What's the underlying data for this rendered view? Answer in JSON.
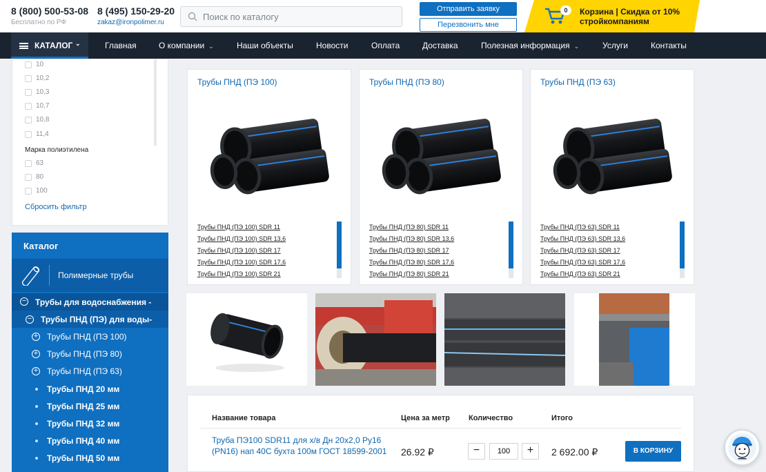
{
  "header": {
    "phone1": "8 (800) 500-53-08",
    "phone1_note": "Бесплатно по РФ",
    "phone2": "8 (495) 150-29-20",
    "email": "zakaz@ironpolimer.ru",
    "search_placeholder": "Поиск по каталогу",
    "request_button": "Отправить заявку",
    "callback_button": "Перезвонить мне",
    "cart_count": "0",
    "cart_text": "Корзина | Скидка от 10% стройкомпаниям"
  },
  "nav": {
    "catalog_label": "КАТАЛОГ",
    "items": [
      "Главная",
      "О компании",
      "Наши объекты",
      "Новости",
      "Оплата",
      "Доставка",
      "Полезная информация",
      "Услуги",
      "Контакты"
    ]
  },
  "filter": {
    "diameter_options": [
      "10",
      "10,2",
      "10,3",
      "10,7",
      "10,8",
      "11,4"
    ],
    "pe_title": "Марка полиэтилена",
    "pe_options": [
      "63",
      "80",
      "100"
    ],
    "reset_label": "Сбросить фильтр"
  },
  "catalog": {
    "title": "Каталог",
    "section": "Полимерные трубы",
    "rows": [
      {
        "label": "Трубы для водоснабжения -",
        "mark": "−"
      },
      {
        "label": "Трубы ПНД (ПЭ) для воды-",
        "mark": "−"
      },
      {
        "label": "Трубы ПНД (ПЭ 100)",
        "mark": "+"
      },
      {
        "label": "Трубы ПНД (ПЭ 80)",
        "mark": "+"
      },
      {
        "label": "Трубы ПНД (ПЭ 63)",
        "mark": "+"
      },
      {
        "label": "Трубы ПНД 20 мм",
        "mark": "•"
      },
      {
        "label": "Трубы ПНД 25 мм",
        "mark": "•"
      },
      {
        "label": "Трубы ПНД 32 мм",
        "mark": "•"
      },
      {
        "label": "Трубы ПНД 40 мм",
        "mark": "•"
      },
      {
        "label": "Трубы ПНД 50 мм",
        "mark": "•"
      }
    ]
  },
  "cards": [
    {
      "title": "Трубы ПНД (ПЭ 100)",
      "links": [
        "Трубы ПНД (ПЭ 100) SDR 11",
        "Трубы ПНД (ПЭ 100) SDR 13,6",
        "Трубы ПНД (ПЭ 100) SDR 17",
        "Трубы ПНД (ПЭ 100) SDR 17,6",
        "Трубы ПНД (ПЭ 100) SDR 21"
      ]
    },
    {
      "title": "Трубы ПНД (ПЭ 80)",
      "links": [
        "Трубы ПНД (ПЭ 80) SDR 11",
        "Трубы ПНД (ПЭ 80) SDR 13,6",
        "Трубы ПНД (ПЭ 80) SDR 17",
        "Трубы ПНД (ПЭ 80) SDR 17,6",
        "Трубы ПНД (ПЭ 80) SDR 21"
      ]
    },
    {
      "title": "Трубы ПНД (ПЭ 63)",
      "links": [
        "Трубы ПНД (ПЭ 63) SDR 11",
        "Трубы ПНД (ПЭ 63) SDR 13,6",
        "Трубы ПНД (ПЭ 63) SDR 17",
        "Трубы ПНД (ПЭ 63) SDR 17,6",
        "Трубы ПНД (ПЭ 63) SDR 21"
      ]
    }
  ],
  "table": {
    "headers": [
      "Название товара",
      "Цена за метр",
      "Количество",
      "Итого"
    ],
    "product_name": "Труба ПЭ100 SDR11 для х/в Дн 20х2,0 Ру16 (PN16) нап 40С бухта 100м ГОСТ 18599-2001",
    "price": "26.92 ₽",
    "quantity": "100",
    "total": "2 692.00 ₽",
    "add_button": "В КОРЗИНУ"
  },
  "colors": {
    "brand_blue": "#0f6fc0",
    "nav_dark": "#1a2330",
    "cart_yellow": "#ffd400"
  }
}
